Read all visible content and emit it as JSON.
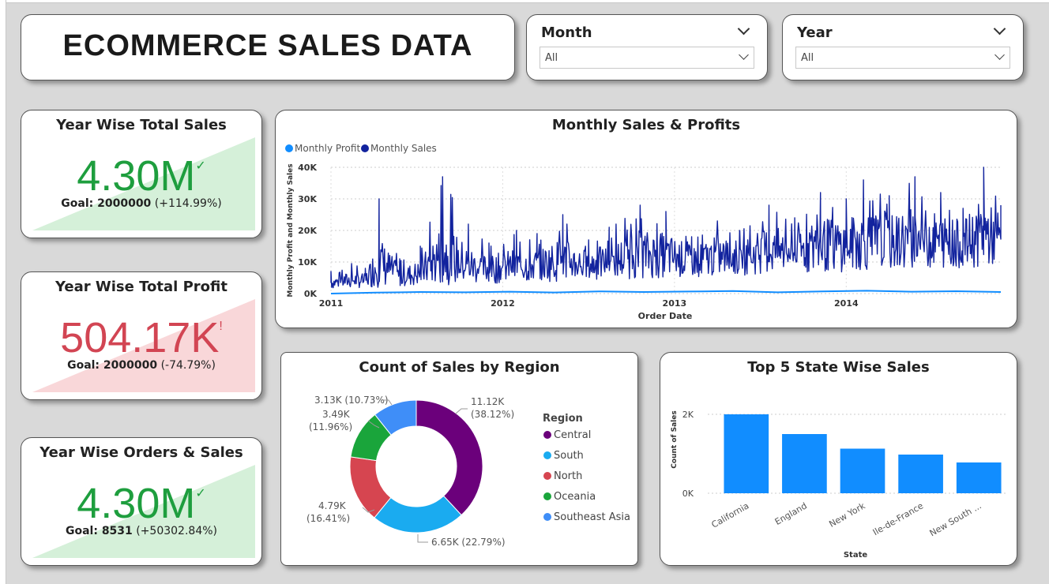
{
  "title": "ECOMMERCE SALES DATA",
  "slicers": [
    {
      "label": "Month",
      "value": "All"
    },
    {
      "label": "Year",
      "value": "All"
    }
  ],
  "kpis": [
    {
      "title": "Year Wise Total Sales",
      "value": "4.30M",
      "mark": "✓",
      "goal_label": "Goal: 2000000",
      "goal_delta": "(+114.99%)",
      "status": "good",
      "color": "#1e9e3e",
      "fill": "#d5f0d9"
    },
    {
      "title": "Year Wise Total Profit",
      "value": "504.17K",
      "mark": "!",
      "goal_label": "Goal: 2000000",
      "goal_delta": "(-74.79%)",
      "status": "bad",
      "color": "#d24553",
      "fill": "#f9d7d9"
    },
    {
      "title": "Year Wise Orders & Sales",
      "value": "4.30M",
      "mark": "✓",
      "goal_label": "Goal: 8531",
      "goal_delta": "(+50302.84%)",
      "status": "good",
      "color": "#1e9e3e",
      "fill": "#d5f0d9"
    }
  ],
  "colors": {
    "monthly_sales": "#12239e",
    "monthly_profit": "#118dff",
    "bar": "#118dff"
  },
  "chart_data": [
    {
      "type": "line",
      "title": "Monthly Sales & Profits",
      "xlabel": "Order Date",
      "ylabel": "Monthly Profit and Monthly Sales",
      "xlim": [
        2011,
        2014.9
      ],
      "ylim": [
        0,
        40000
      ],
      "x_ticks": [
        2011,
        2012,
        2013,
        2014
      ],
      "x_tick_labels": [
        "2011",
        "2012",
        "2013",
        "2014"
      ],
      "y_ticks": [
        0,
        10000,
        20000,
        30000,
        40000
      ],
      "y_tick_labels": [
        "0K",
        "10K",
        "20K",
        "30K",
        "40K"
      ],
      "grid": true,
      "legend_position": "top-left",
      "series": [
        {
          "name": "Monthly Profit",
          "values": [
            0,
            300,
            500,
            400,
            600,
            350,
            700,
            500,
            650,
            800,
            400,
            700,
            900,
            600,
            750,
            500
          ],
          "color": "#118dff"
        },
        {
          "name": "Monthly Sales",
          "color": "#12239e",
          "peaks": [
            [
              2011.0,
              7000
            ],
            [
              2011.12,
              9500
            ],
            [
              2011.2,
              8000
            ],
            [
              2011.28,
              30000
            ],
            [
              2011.4,
              11000
            ],
            [
              2011.52,
              15000
            ],
            [
              2011.65,
              37000
            ],
            [
              2011.8,
              22000
            ],
            [
              2011.92,
              16000
            ],
            [
              2012.08,
              20000
            ],
            [
              2012.2,
              19000
            ],
            [
              2012.35,
              25000
            ],
            [
              2012.5,
              17000
            ],
            [
              2012.62,
              21000
            ],
            [
              2012.8,
              28000
            ],
            [
              2012.95,
              26000
            ],
            [
              2013.1,
              18000
            ],
            [
              2013.25,
              23000
            ],
            [
              2013.38,
              20000
            ],
            [
              2013.55,
              28000
            ],
            [
              2013.7,
              24000
            ],
            [
              2013.85,
              32000
            ],
            [
              2014.0,
              30000
            ],
            [
              2014.1,
              36000
            ],
            [
              2014.25,
              31000
            ],
            [
              2014.4,
              37000
            ],
            [
              2014.55,
              32000
            ],
            [
              2014.68,
              27000
            ],
            [
              2014.8,
              40000
            ],
            [
              2014.9,
              28000
            ]
          ]
        }
      ]
    },
    {
      "type": "pie",
      "title": "Count of Sales by Region",
      "legend_title": "Region",
      "legend_position": "right",
      "slices": [
        {
          "name": "Central",
          "value": 11120,
          "label": "11.12K",
          "pct": "(38.12%)",
          "color": "#6b007b"
        },
        {
          "name": "South",
          "value": 6650,
          "label": "6.65K (22.79%)",
          "pct": "",
          "color": "#1aabf0"
        },
        {
          "name": "North",
          "value": 4790,
          "label": "4.79K",
          "pct": "(16.41%)",
          "color": "#d64550"
        },
        {
          "name": "Oceania",
          "value": 3490,
          "label": "3.49K",
          "pct": "(11.96%)",
          "color": "#1aa53b"
        },
        {
          "name": "Southeast Asia",
          "value": 3130,
          "label": "3.13K (10.73%)",
          "pct": "",
          "color": "#3f8ef8"
        }
      ]
    },
    {
      "type": "bar",
      "title": "Top 5 State Wise Sales",
      "xlabel": "State",
      "ylabel": "Count of Sales",
      "categories": [
        "California",
        "England",
        "New York",
        "Ile-de-France",
        "New South ..."
      ],
      "values": [
        2000,
        1500,
        1130,
        980,
        780
      ],
      "ylim": [
        0,
        2600
      ],
      "y_ticks": [
        0,
        2000
      ],
      "y_tick_labels": [
        "0K",
        "2K"
      ],
      "grid": true
    }
  ]
}
